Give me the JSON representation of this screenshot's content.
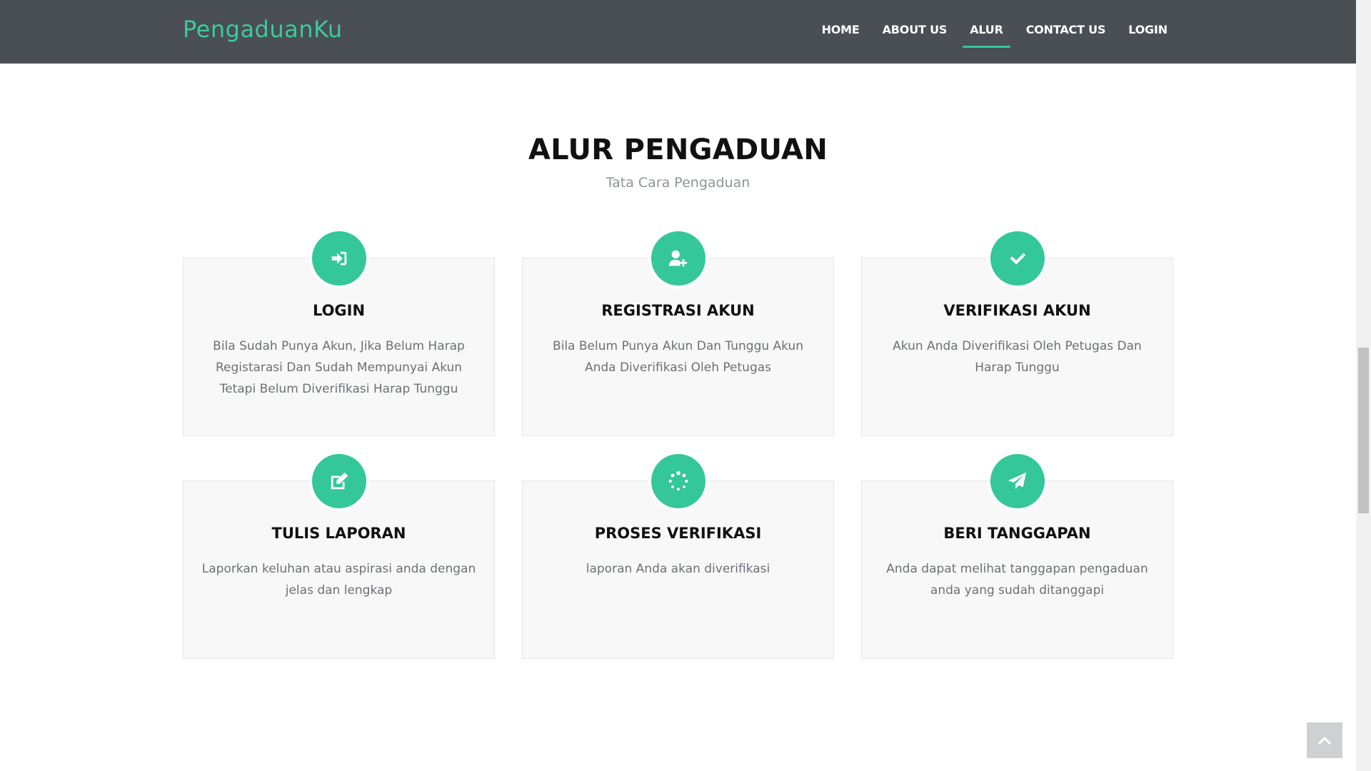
{
  "header": {
    "logo": "PengaduanKu",
    "nav": [
      {
        "label": "HOME",
        "active": false
      },
      {
        "label": "ABOUT US",
        "active": false
      },
      {
        "label": "ALUR",
        "active": true
      },
      {
        "label": "CONTACT US",
        "active": false
      },
      {
        "label": "LOGIN",
        "active": false
      }
    ]
  },
  "section": {
    "title": "ALUR PENGADUAN",
    "subtitle": "Tata Cara Pengaduan"
  },
  "cards": [
    {
      "icon": "sign-in-icon",
      "title": "LOGIN",
      "desc": "Bila Sudah Punya Akun, Jika Belum Harap Registarasi Dan Sudah Mempunyai Akun Tetapi Belum Diverifikasi Harap Tunggu"
    },
    {
      "icon": "user-plus-icon",
      "title": "REGISTRASI AKUN",
      "desc": "Bila Belum Punya Akun Dan Tunggu Akun Anda Diverifikasi Oleh Petugas"
    },
    {
      "icon": "check-icon",
      "title": "VERIFIKASI AKUN",
      "desc": "Akun Anda Diverifikasi Oleh Petugas Dan Harap Tunggu"
    },
    {
      "icon": "edit-icon",
      "title": "TULIS LAPORAN",
      "desc": "Laporkan keluhan atau aspirasi anda dengan jelas dan lengkap"
    },
    {
      "icon": "spinner-icon",
      "title": "PROSES VERIFIKASI",
      "desc": "laporan Anda akan diverifikasi"
    },
    {
      "icon": "paper-plane-icon",
      "title": "BERI TANGGAPAN",
      "desc": "Anda dapat melihat tanggapan pengaduan anda yang sudah ditanggapi"
    }
  ],
  "colors": {
    "header_bg": "#4a4e55",
    "accent": "#34c79a",
    "card_bg": "#f8f8f8"
  }
}
